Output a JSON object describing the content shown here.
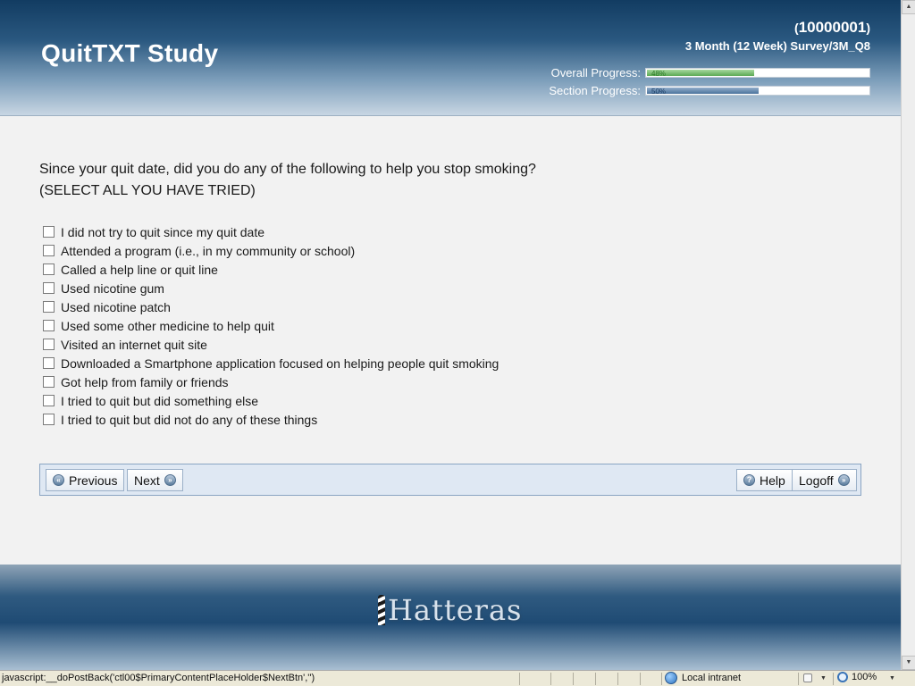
{
  "header": {
    "title": "QuitTXT Study",
    "participant_open": "(",
    "participant_id": "10000001",
    "participant_close": ")",
    "survey_name": "3 Month (12 Week) Survey/3M_Q8",
    "overall_progress": {
      "label": "Overall Progress:",
      "value_text": "48%",
      "value": 0.48
    },
    "section_progress": {
      "label": "Section Progress:",
      "value_text": "50%",
      "value": 0.5
    },
    "colors": {
      "header_dark": "#123c62",
      "overall_bar": "#5aa852",
      "section_bar": "#4a739c"
    }
  },
  "question": {
    "text": "Since your quit date, did you do any of the following to help you stop smoking?",
    "instruction": "(SELECT ALL YOU HAVE TRIED)",
    "options": [
      {
        "label": "I did not try to quit since my quit date",
        "checked": false
      },
      {
        "label": "Attended a program (i.e., in my community or school)",
        "checked": false
      },
      {
        "label": "Called a help line or quit line",
        "checked": false
      },
      {
        "label": "Used nicotine gum",
        "checked": false
      },
      {
        "label": "Used nicotine patch",
        "checked": false
      },
      {
        "label": "Used some other medicine to help quit",
        "checked": false
      },
      {
        "label": "Visited an internet quit site",
        "checked": false
      },
      {
        "label": "Downloaded a Smartphone application focused on helping people quit smoking",
        "checked": false
      },
      {
        "label": "Got help from family or friends",
        "checked": false
      },
      {
        "label": "I tried to quit but did something else",
        "checked": false
      },
      {
        "label": "I tried to quit but did not do any of these things",
        "checked": false
      }
    ]
  },
  "nav": {
    "previous": {
      "label": "Previous",
      "icon": "double-left-arrow-icon"
    },
    "next": {
      "label": "Next",
      "icon": "double-right-arrow-icon"
    },
    "help": {
      "label": "Help",
      "icon": "question-icon"
    },
    "logoff": {
      "label": "Logoff",
      "icon": "double-right-arrow-icon"
    }
  },
  "footer": {
    "logo_text": "Hatteras"
  },
  "statusbar": {
    "message": "javascript:__doPostBack('ctl00$PrimaryContentPlaceHolder$NextBtn','')",
    "zone": "Local intranet",
    "zoom": "100%"
  }
}
